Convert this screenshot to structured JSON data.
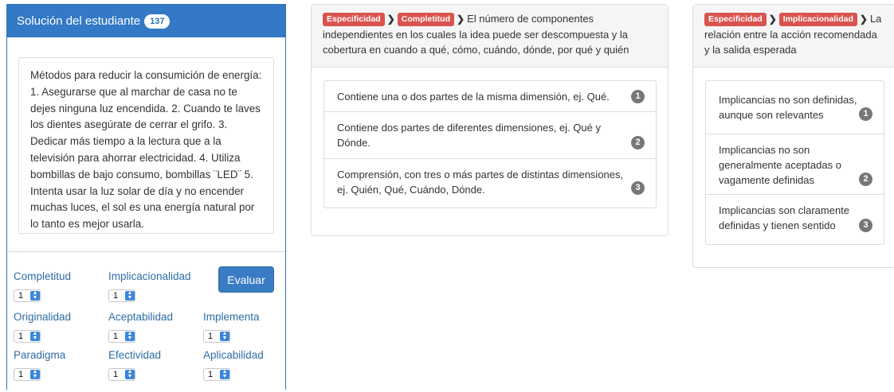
{
  "student": {
    "title": "Solución del estudiante",
    "count": "137",
    "answer": "Métodos para reducir la consumición de energía: 1. Asegurarse que al marchar de casa no te dejes ninguna luz encendida. 2. Cuando te laves los dientes asegúrate de cerrar el grifo. 3. Dedicar más tiempo a la lectura que a la televisión para ahorrar electricidad. 4. Utiliza bombillas de bajo consumo, bombillas ¨LED¨ 5. Intenta usar la luz solar de día y no encender muchas luces, el sol es una energía natural por lo tanto es mejor usarla.",
    "evaluate_label": "Evaluar",
    "ratings": [
      {
        "label": "Completitud",
        "value": "1"
      },
      {
        "label": "Implicacionalidad",
        "value": "1"
      },
      {
        "label": "Originalidad",
        "value": "1"
      },
      {
        "label": "Aceptabilidad",
        "value": "1"
      },
      {
        "label": "Implementa",
        "value": "1"
      },
      {
        "label": "Paradigma",
        "value": "1"
      },
      {
        "label": "Efectividad",
        "value": "1"
      },
      {
        "label": "Aplicabilidad",
        "value": "1"
      }
    ]
  },
  "completitud_panel": {
    "tag1": "Especificidad",
    "tag2": "Completitud",
    "description": "El número de componentes independientes en los cuales la idea puede ser descompuesta y la cobertura en cuando a qué, cómo, cuándo, dónde, por qué y quién",
    "levels": [
      {
        "text": "Contiene una o dos partes de la misma dimensión, ej. Qué.",
        "badge": "1"
      },
      {
        "text": "Contiene dos partes de diferentes dimensiones, ej. Qué y Dónde.",
        "badge": "2"
      },
      {
        "text": "Comprensión, con tres o más partes de distintas dimensiones, ej. Quién, Qué, Cuándo, Dónde.",
        "badge": "3"
      }
    ]
  },
  "implicacionalidad_panel": {
    "tag1": "Especificidad",
    "tag2": "Implicacionalidad",
    "description": "La relación entre la acción recomendada y la salida esperada",
    "levels": [
      {
        "text": "Implicancias no son definidas, aunque son relevantes",
        "badge": "1"
      },
      {
        "text": "Implicancias no son generalmente aceptadas o vagamente definidas",
        "badge": "2"
      },
      {
        "text": "Implicancias son claramente definidas y tienen sentido",
        "badge": "3"
      }
    ]
  },
  "colors": {
    "primary": "#3379c6",
    "danger": "#d9534f",
    "badge": "#777777",
    "link": "#2e6da4"
  }
}
